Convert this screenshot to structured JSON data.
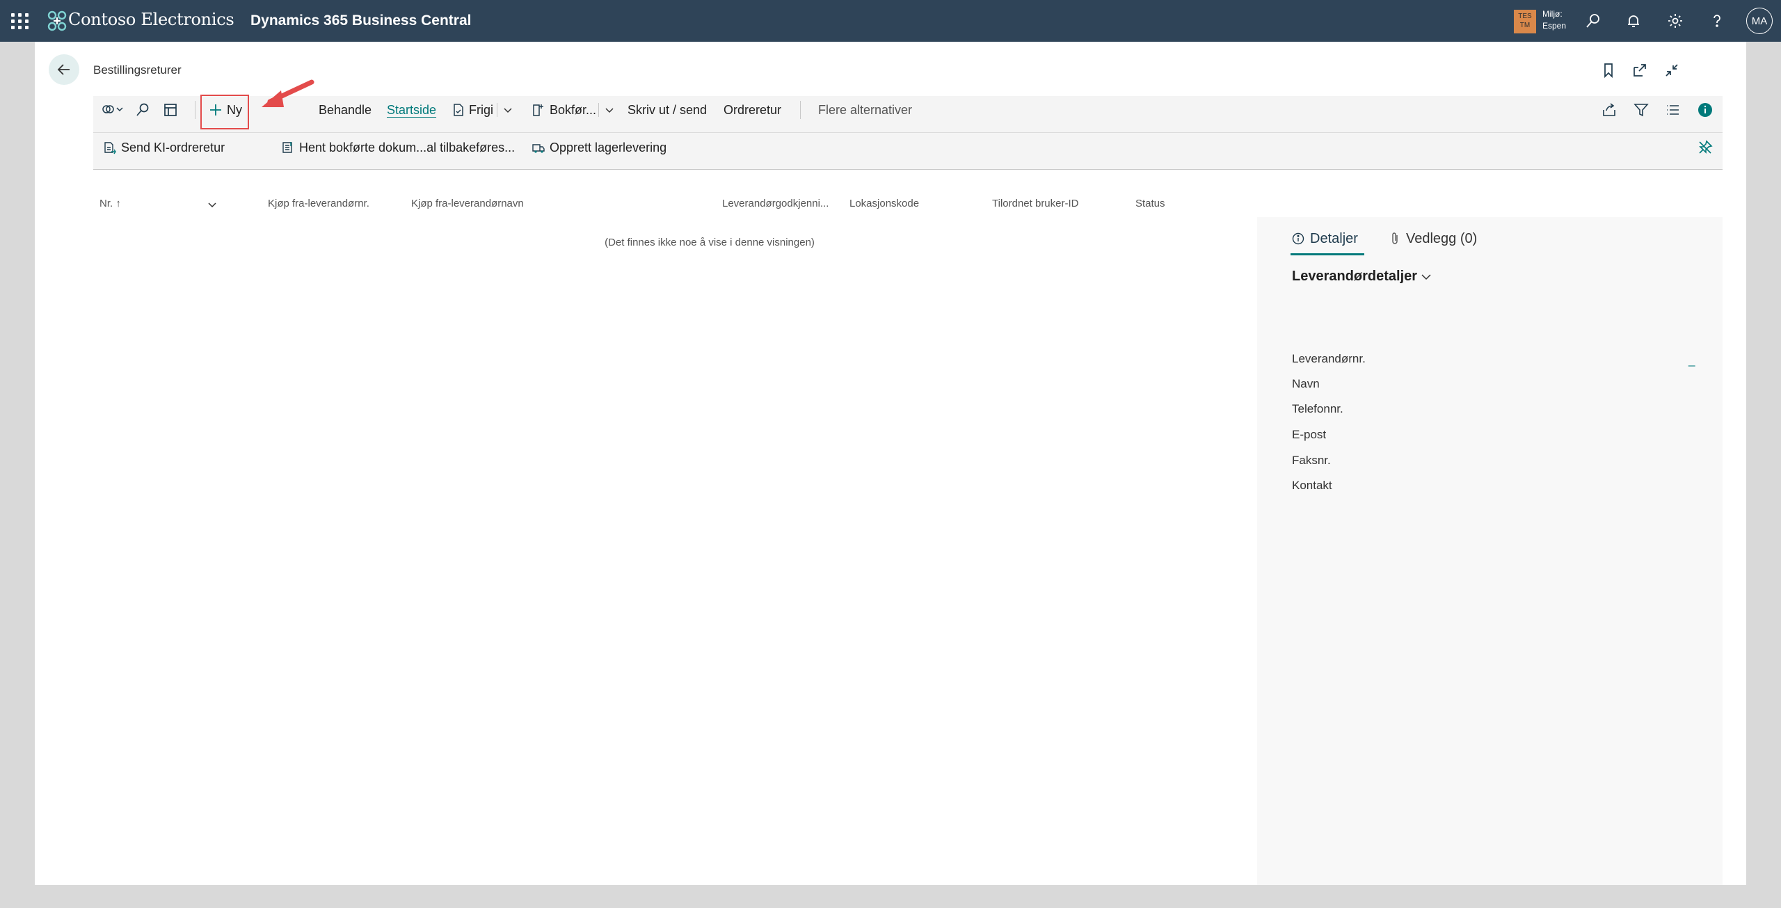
{
  "topbar": {
    "brand": "Contoso Electronics",
    "product": "Dynamics 365 Business Central",
    "env_badge_line1": "TES",
    "env_badge_line2": "TM",
    "env_label": "Miljø:",
    "env_name": "Espen",
    "user_initials": "MA",
    "icons": [
      "app-launcher-icon",
      "search-icon",
      "bell-icon",
      "gear-icon",
      "help-icon"
    ]
  },
  "page": {
    "title": "Bestillingsreturer",
    "header_icons": [
      "bookmark-icon",
      "open-new-window-icon",
      "collapse-icon"
    ]
  },
  "actions": {
    "new": "Ny",
    "process": "Behandle",
    "home": "Startside",
    "release": "Frigi",
    "post": "Bokfør...",
    "print_send": "Skriv ut / send",
    "order_return": "Ordreretur",
    "more": "Flere alternativer",
    "send_ai": "Send KI-ordreretur",
    "get_posted": "Hent bokførte dokum...al tilbakeføres...",
    "create_whse": "Opprett lagerlevering"
  },
  "list": {
    "columns": [
      "Nr. ↑",
      "Kjøp fra-leverandørnr.",
      "Kjøp fra-leverandørnavn",
      "Leverandørgodkjenni...",
      "Lokasjonskode",
      "Tilordnet bruker-ID",
      "Status"
    ],
    "empty_message": "(Det finnes ikke noe å vise i denne visningen)"
  },
  "factbox": {
    "tab_details": "Detaljer",
    "tab_attachments": "Vedlegg (0)",
    "section": "Leverandørdetaljer",
    "fields": [
      "Leverandørnr.",
      "Navn",
      "Telefonnr.",
      "E-post",
      "Faksnr.",
      "Kontakt"
    ],
    "vendor_no_value": "_"
  },
  "colors": {
    "topbar": "#2f4458",
    "accent": "#00797a",
    "highlight": "#e34b4b"
  }
}
